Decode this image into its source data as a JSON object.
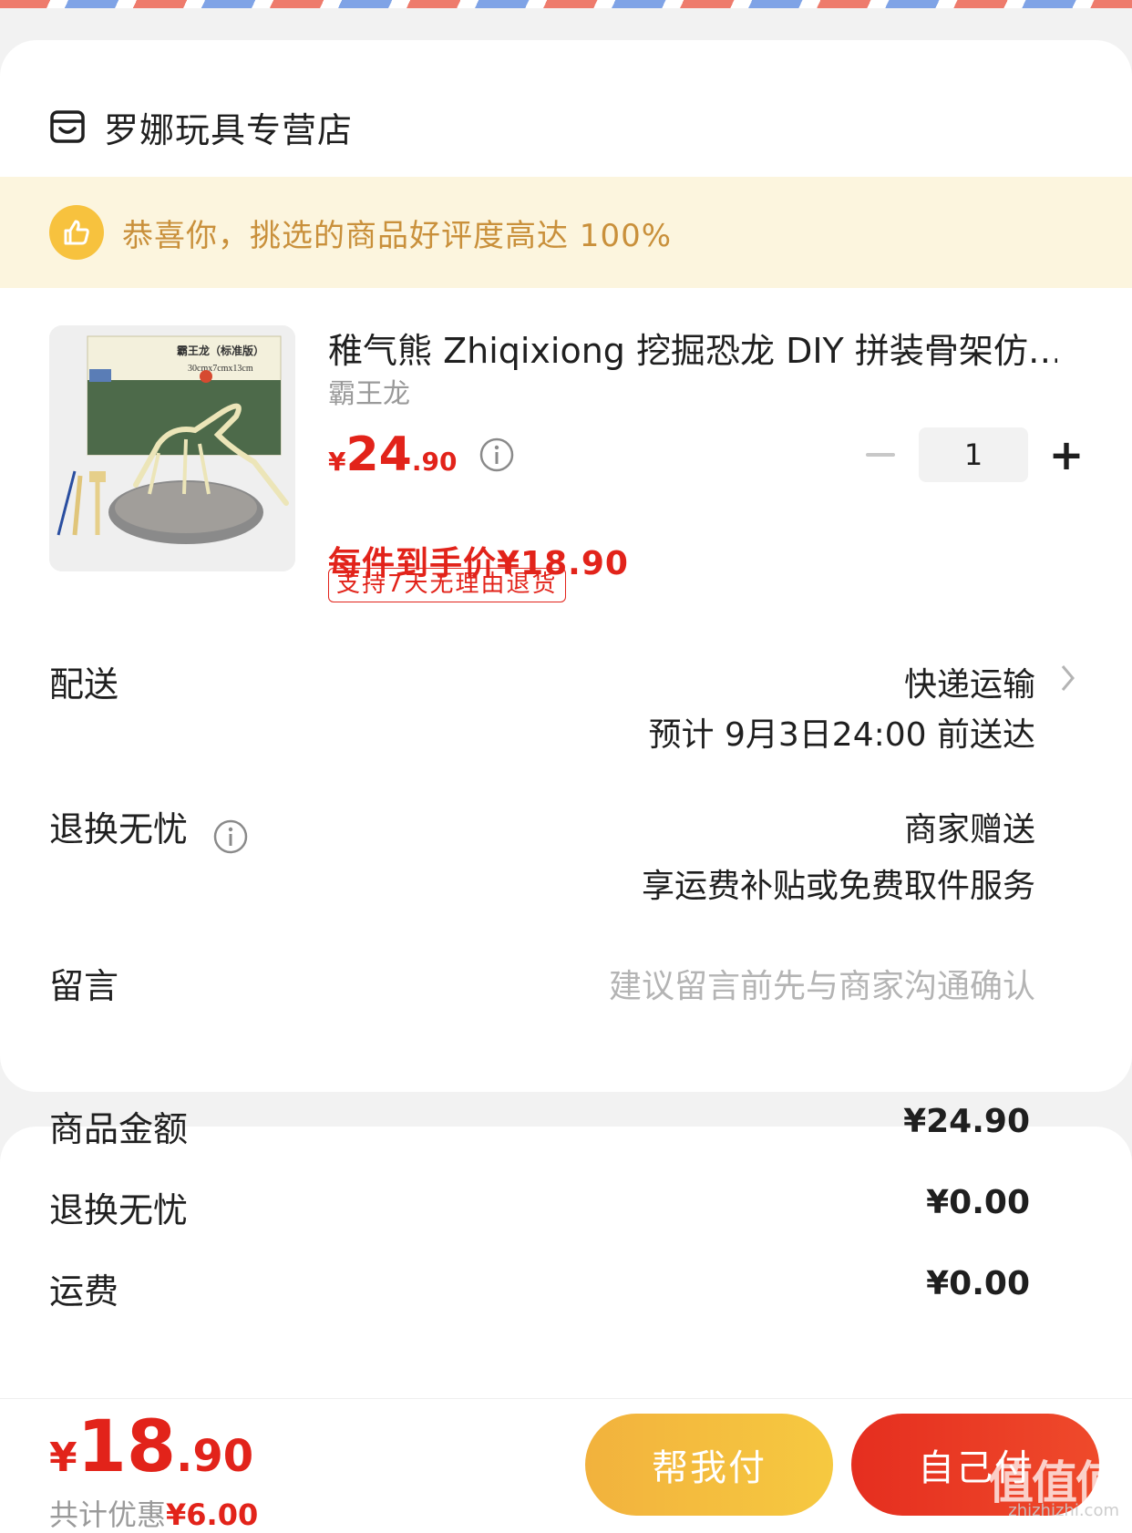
{
  "shop": {
    "name": "罗娜玩具专营店"
  },
  "banner": {
    "text": "恭喜你，挑选的商品好评度高达 100%"
  },
  "product": {
    "image_label_title": "霸王龙（标准版）",
    "image_label_size": "30cmx7cmx13cm",
    "title": "稚气熊 Zhiqixiong 挖掘恐龙 DIY 拼装骨架仿…",
    "variant": "霸王龙",
    "price_symbol": "¥",
    "price_int": "24",
    "price_dec": ".90",
    "promo_price": "每件到手价¥18.90",
    "return_badge": "支持7天无理由退货",
    "quantity": "1"
  },
  "delivery": {
    "label": "配送",
    "method": "快递运输",
    "eta": "预计 9月3日24:00 前送达"
  },
  "worry_free": {
    "label": "退换无忧",
    "value1": "商家赠送",
    "value2": "享运费补贴或免费取件服务"
  },
  "message": {
    "label": "留言",
    "placeholder": "建议留言前先与商家沟通确认"
  },
  "summary": [
    {
      "label": "商品金额",
      "value": "¥24.90"
    },
    {
      "label": "退换无忧",
      "value": "¥0.00"
    },
    {
      "label": "运费",
      "value": "¥0.00"
    }
  ],
  "bottom": {
    "total_symbol": "¥",
    "total_int": "18",
    "total_dec": ".90",
    "discount_label": "共计优惠",
    "discount_value": "¥6.00",
    "help_pay": "帮我付",
    "self_pay": "自己付",
    "watermark": "值值值",
    "watermark_url": "zhizhizhi.com"
  },
  "colors": {
    "accent_red": "#e2231a",
    "banner_bg": "#fcf5de",
    "banner_text": "#c9903b",
    "help_btn": "#f4bd3f",
    "self_btn": "#e8351f"
  }
}
